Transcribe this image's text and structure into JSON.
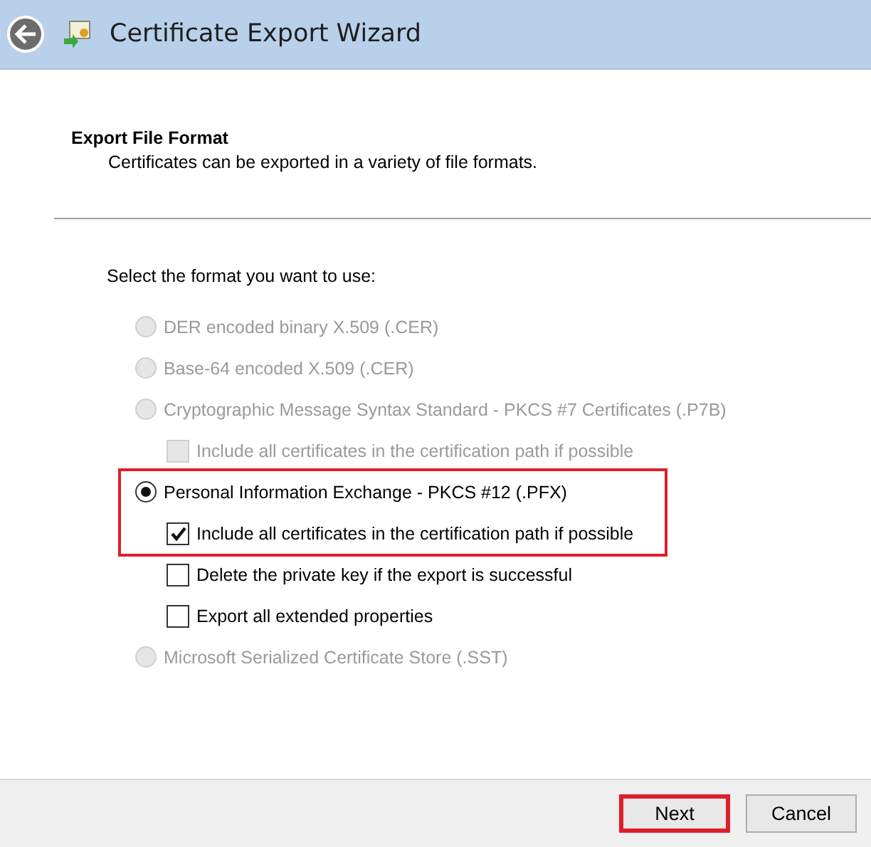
{
  "window": {
    "title": "Certificate Export Wizard"
  },
  "page": {
    "heading": "Export File Format",
    "description": "Certificates can be exported in a variety of file formats."
  },
  "prompt": "Select the format you want to use:",
  "options": [
    {
      "kind": "radio",
      "label": "DER encoded binary X.509 (.CER)",
      "selected": false,
      "disabled": true,
      "highlighted": false
    },
    {
      "kind": "radio",
      "label": "Base-64 encoded X.509 (.CER)",
      "selected": false,
      "disabled": true,
      "highlighted": false
    },
    {
      "kind": "radio",
      "label": "Cryptographic Message Syntax Standard - PKCS #7 Certificates (.P7B)",
      "selected": false,
      "disabled": true,
      "highlighted": false,
      "children": [
        {
          "kind": "checkbox",
          "label": "Include all certificates in the certification path if possible",
          "checked": false,
          "disabled": true,
          "highlighted": false
        }
      ]
    },
    {
      "kind": "radio",
      "label": "Personal Information Exchange - PKCS #12 (.PFX)",
      "selected": true,
      "disabled": false,
      "highlighted": true,
      "children": [
        {
          "kind": "checkbox",
          "label": "Include all certificates in the certification path if possible",
          "checked": true,
          "disabled": false,
          "highlighted": true
        },
        {
          "kind": "checkbox",
          "label": "Delete the private key if the export is successful",
          "checked": false,
          "disabled": false,
          "highlighted": false
        },
        {
          "kind": "checkbox",
          "label": "Export all extended properties",
          "checked": false,
          "disabled": false,
          "highlighted": false
        }
      ]
    },
    {
      "kind": "radio",
      "label": "Microsoft Serialized Certificate Store (.SST)",
      "selected": false,
      "disabled": true,
      "highlighted": false
    }
  ],
  "buttons": [
    {
      "label": "Next",
      "highlighted": true
    },
    {
      "label": "Cancel",
      "highlighted": false
    }
  ]
}
